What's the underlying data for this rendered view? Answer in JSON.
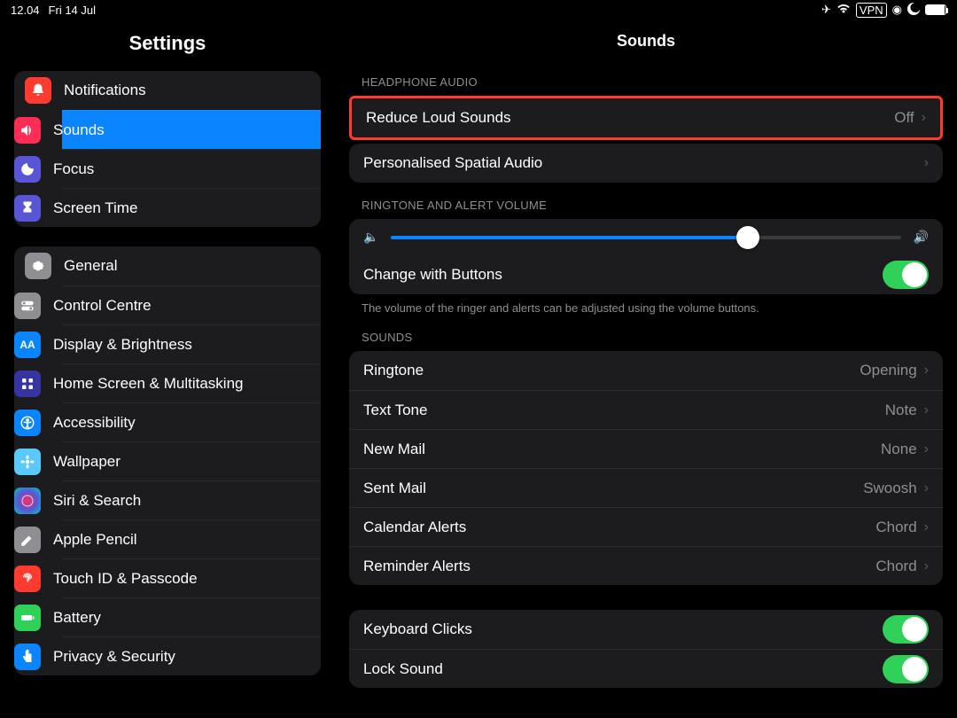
{
  "status": {
    "time": "12.04",
    "date": "Fri 14 Jul",
    "airplane": "✈",
    "wifi": "􀙇",
    "vpn": "VPN",
    "locate": "􀋒",
    "moon": "🌙"
  },
  "sidebar": {
    "title": "Settings",
    "group1": [
      {
        "label": "Notifications"
      },
      {
        "label": "Sounds"
      },
      {
        "label": "Focus"
      },
      {
        "label": "Screen Time"
      }
    ],
    "group2": [
      {
        "label": "General"
      },
      {
        "label": "Control Centre"
      },
      {
        "label": "Display & Brightness"
      },
      {
        "label": "Home Screen & Multitasking"
      },
      {
        "label": "Accessibility"
      },
      {
        "label": "Wallpaper"
      },
      {
        "label": "Siri & Search"
      },
      {
        "label": "Apple Pencil"
      },
      {
        "label": "Touch ID & Passcode"
      },
      {
        "label": "Battery"
      },
      {
        "label": "Privacy & Security"
      }
    ]
  },
  "content": {
    "title": "Sounds",
    "headphone_section": "HEADPHONE AUDIO",
    "reduce_loud": {
      "label": "Reduce Loud Sounds",
      "value": "Off"
    },
    "spatial": {
      "label": "Personalised Spatial Audio"
    },
    "ringtone_section": "RINGTONE AND ALERT VOLUME",
    "change_buttons": {
      "label": "Change with Buttons"
    },
    "volume_footer": "The volume of the ringer and alerts can be adjusted using the volume buttons.",
    "sounds_section": "SOUNDS",
    "sounds": [
      {
        "label": "Ringtone",
        "value": "Opening"
      },
      {
        "label": "Text Tone",
        "value": "Note"
      },
      {
        "label": "New Mail",
        "value": "None"
      },
      {
        "label": "Sent Mail",
        "value": "Swoosh"
      },
      {
        "label": "Calendar Alerts",
        "value": "Chord"
      },
      {
        "label": "Reminder Alerts",
        "value": "Chord"
      }
    ],
    "keyboard_clicks": {
      "label": "Keyboard Clicks"
    },
    "lock_sound": {
      "label": "Lock Sound"
    }
  }
}
